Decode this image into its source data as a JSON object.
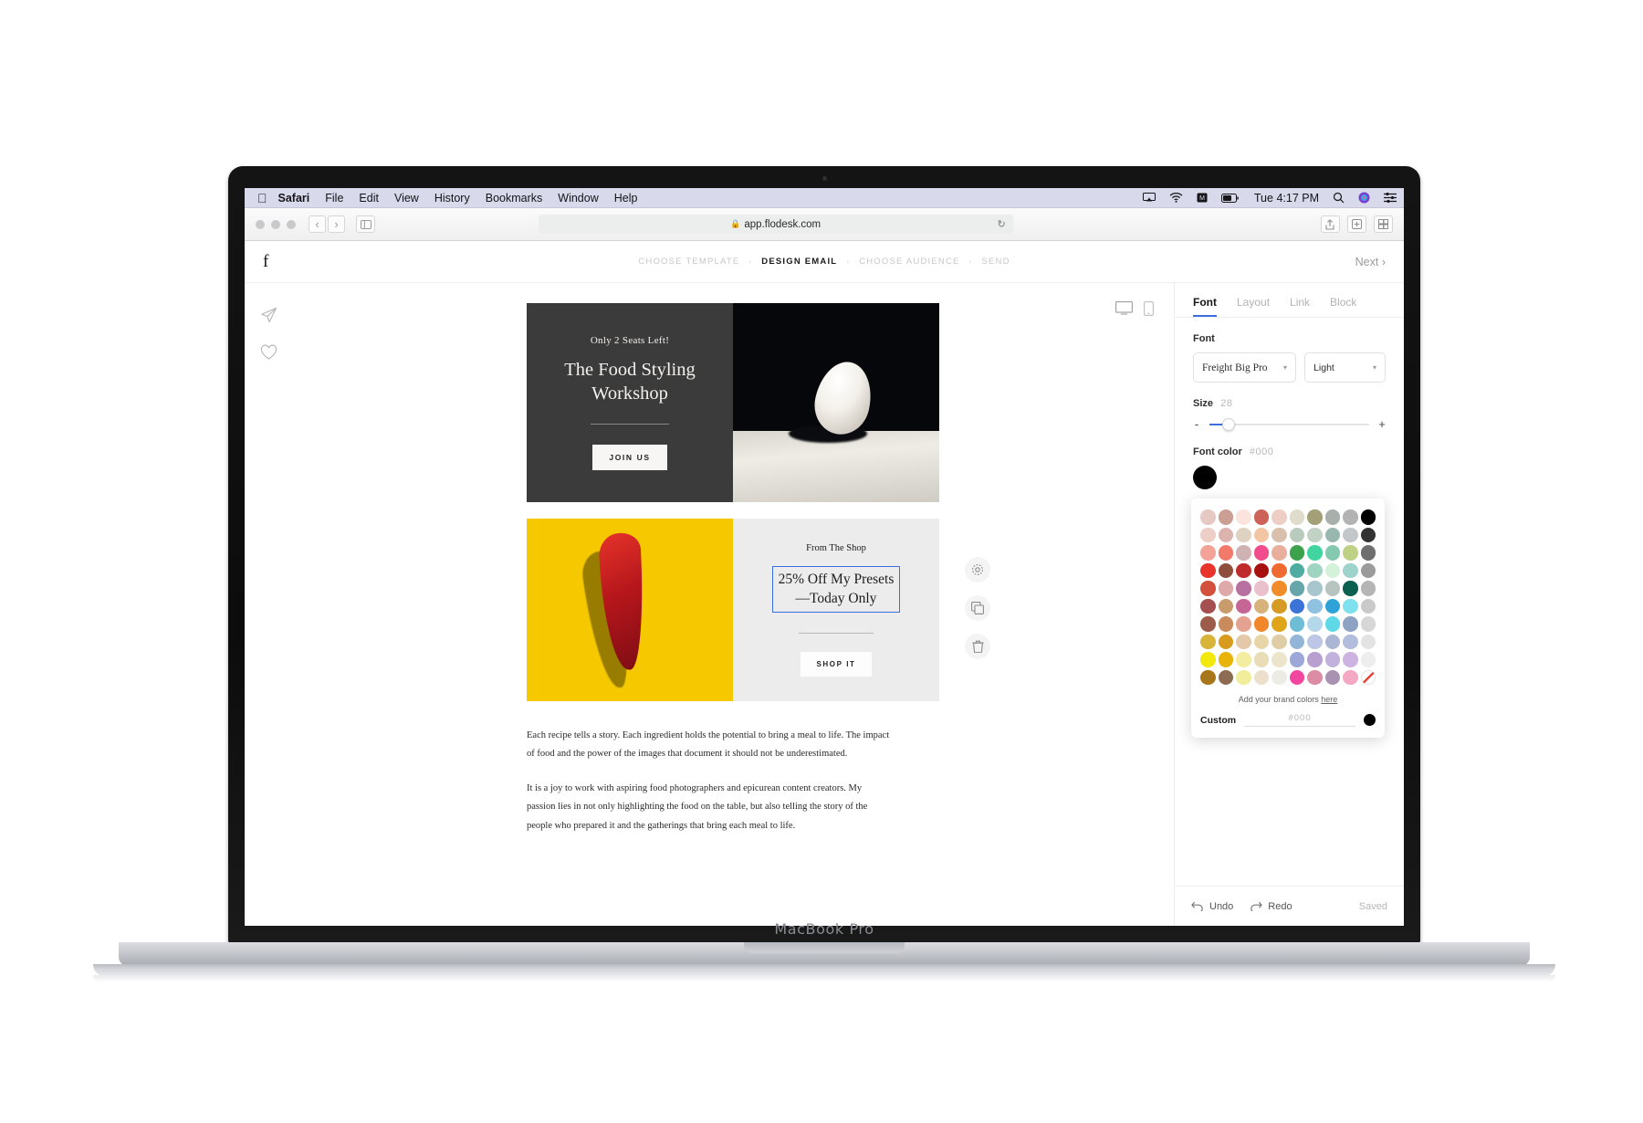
{
  "menubar": {
    "apple_icon": "apple-icon",
    "items": [
      "Safari",
      "File",
      "Edit",
      "View",
      "History",
      "Bookmarks",
      "Window",
      "Help"
    ],
    "active_app": "Safari",
    "status_icons": [
      "airplay-icon",
      "wifi-icon",
      "input-source-icon",
      "battery-icon"
    ],
    "clock": "Tue 4:17 PM",
    "right_icons": [
      "search-icon",
      "siri-icon",
      "control-center-icon"
    ]
  },
  "safari": {
    "url": "app.flodesk.com",
    "lock_icon": "lock-icon",
    "reload_icon": "reload-icon",
    "back_icon": "chevron-left-icon",
    "forward_icon": "chevron-right-icon",
    "sidebar_icon": "sidebar-icon",
    "share_icon": "share-icon",
    "tabs_icon": "new-tab-icon"
  },
  "app": {
    "logo": "f",
    "breadcrumb": [
      {
        "label": "CHOOSE TEMPLATE",
        "active": false
      },
      {
        "label": "DESIGN EMAIL",
        "active": true
      },
      {
        "label": "CHOOSE AUDIENCE",
        "active": false
      },
      {
        "label": "SEND",
        "active": false
      }
    ],
    "next_label": "Next",
    "next_icon": "chevron-right-icon",
    "rail_icons": [
      "send-icon",
      "heart-icon"
    ],
    "device_toggle": [
      "desktop-icon",
      "mobile-icon"
    ]
  },
  "email": {
    "hero": {
      "kicker": "Only 2 Seats Left!",
      "title_line1": "The Food Styling",
      "title_line2": "Workshop",
      "button": "JOIN US",
      "image_alt": "white-egg-on-marble-photo"
    },
    "shop": {
      "kicker": "From The Shop",
      "headline_line1": "25% Off My Presets",
      "headline_line2": "—Today Only",
      "button": "SHOP IT",
      "image_alt": "red-pepper-on-yellow-photo"
    },
    "block_tools": [
      "settings-icon",
      "duplicate-icon",
      "trash-icon"
    ],
    "paragraphs": [
      "Each recipe tells a story. Each ingredient holds the potential to bring a meal to life. The impact of food and the power of the images that document it should not be underestimated.",
      "It is a joy to work with aspiring food photographers and epicurean content creators. My passion lies in not only highlighting the food on the table, but also telling the story of the people who prepared it and the gatherings that bring each meal to life."
    ]
  },
  "panel": {
    "tabs": [
      {
        "label": "Font",
        "active": true
      },
      {
        "label": "Layout",
        "active": false
      },
      {
        "label": "Link",
        "active": false
      },
      {
        "label": "Block",
        "active": false
      }
    ],
    "font_label": "Font",
    "font_family": "Freight Big Pro",
    "font_weight": "Light",
    "size_label": "Size",
    "size_value": "28",
    "size_minus": "-",
    "size_plus": "+",
    "font_color_label": "Font color",
    "font_color_value": "#000",
    "current_color": "#000000",
    "palette": {
      "brand_text_before": "Add your brand colors",
      "brand_link": "here",
      "custom_label": "Custom",
      "custom_placeholder": "#000",
      "custom_swatch": "#000000",
      "eyedropper_icon": "eyedropper-icon",
      "colors": [
        "#e5c9c2",
        "#cc9f95",
        "#fbe4dd",
        "#cd6358",
        "#edcdc4",
        "#dfdccb",
        "#a39f76",
        "#a9b0ab",
        "#b3b3b3",
        "#e8f0fb",
        "#edcfc8",
        "#ddb3ae",
        "#ded2c1",
        "#f3c5a5",
        "#d8c0ac",
        "#b9cbbc",
        "#c2d3c6",
        "#98b7ae",
        "#c3c7c9",
        "#a9cbee",
        "#f2a296",
        "#f37a6b",
        "#cfb2b3",
        "#f14d8d",
        "#e8b09c",
        "#3da24c",
        "#3fd4a0",
        "#85c9b1",
        "#bfd184",
        "#9fc2cf",
        "#e8342a",
        "#8f4d3c",
        "#c02b2c",
        "#a6100f",
        "#ef6a31",
        "#4faca0",
        "#9fd4c0",
        "#d3f2d9",
        "#9ed3cc",
        "#50a38e",
        "#d2503c",
        "#dfa8a9",
        "#b870a1",
        "#e9c1cd",
        "#f08c2a",
        "#66a6aa",
        "#a8c6cd",
        "#b8c4c0",
        "#0a5f4e",
        "#59b09e",
        "#a64f51",
        "#c99b6a",
        "#c56696",
        "#d8b27b",
        "#d69b24",
        "#3b73d8",
        "#8fc2e0",
        "#2fa3d8",
        "#7fe0ee",
        "#2b2f9e",
        "#9d5c49",
        "#c98a5c",
        "#e4a391",
        "#f1872a",
        "#e0a41b",
        "#6fbcd6",
        "#b4d8ea",
        "#5fd8e8",
        "#8ea2c4",
        "#7ba7cf",
        "#d8b43b",
        "#d99b1e",
        "#e3c9a9",
        "#e8d6a8",
        "#dfcda6",
        "#93b6d8",
        "#bdc7e5",
        "#aab6d4",
        "#b2bddd",
        "#6b95d1",
        "#f2e80c",
        "#e8b40c",
        "#f2eda0",
        "#e8ddb7",
        "#ede4cc",
        "#9da8d8",
        "#b7a0cf",
        "#c0b2dd",
        "#cdb3e2",
        "#3b4ad8",
        "#a8761a",
        "#8d6a52",
        "#f0ed9b",
        "#ece0cd",
        "#ecebe4",
        "#f246a0",
        "#dd8ca5",
        "#a991b2",
        "#f4a8c4",
        "#e8c6f0"
      ],
      "right_column": [
        "#000000",
        "#333333",
        "#6e6e6e",
        "#9b9b9b",
        "#b5b5b5",
        "#c9c9c9",
        "#d7d7d7",
        "#e3e3e3",
        "#eeeeee",
        "#ffffff"
      ]
    },
    "footer": {
      "undo": "Undo",
      "undo_icon": "undo-icon",
      "redo": "Redo",
      "redo_icon": "redo-icon",
      "saved": "Saved"
    }
  },
  "laptop": {
    "model_label": "MacBook Pro"
  }
}
